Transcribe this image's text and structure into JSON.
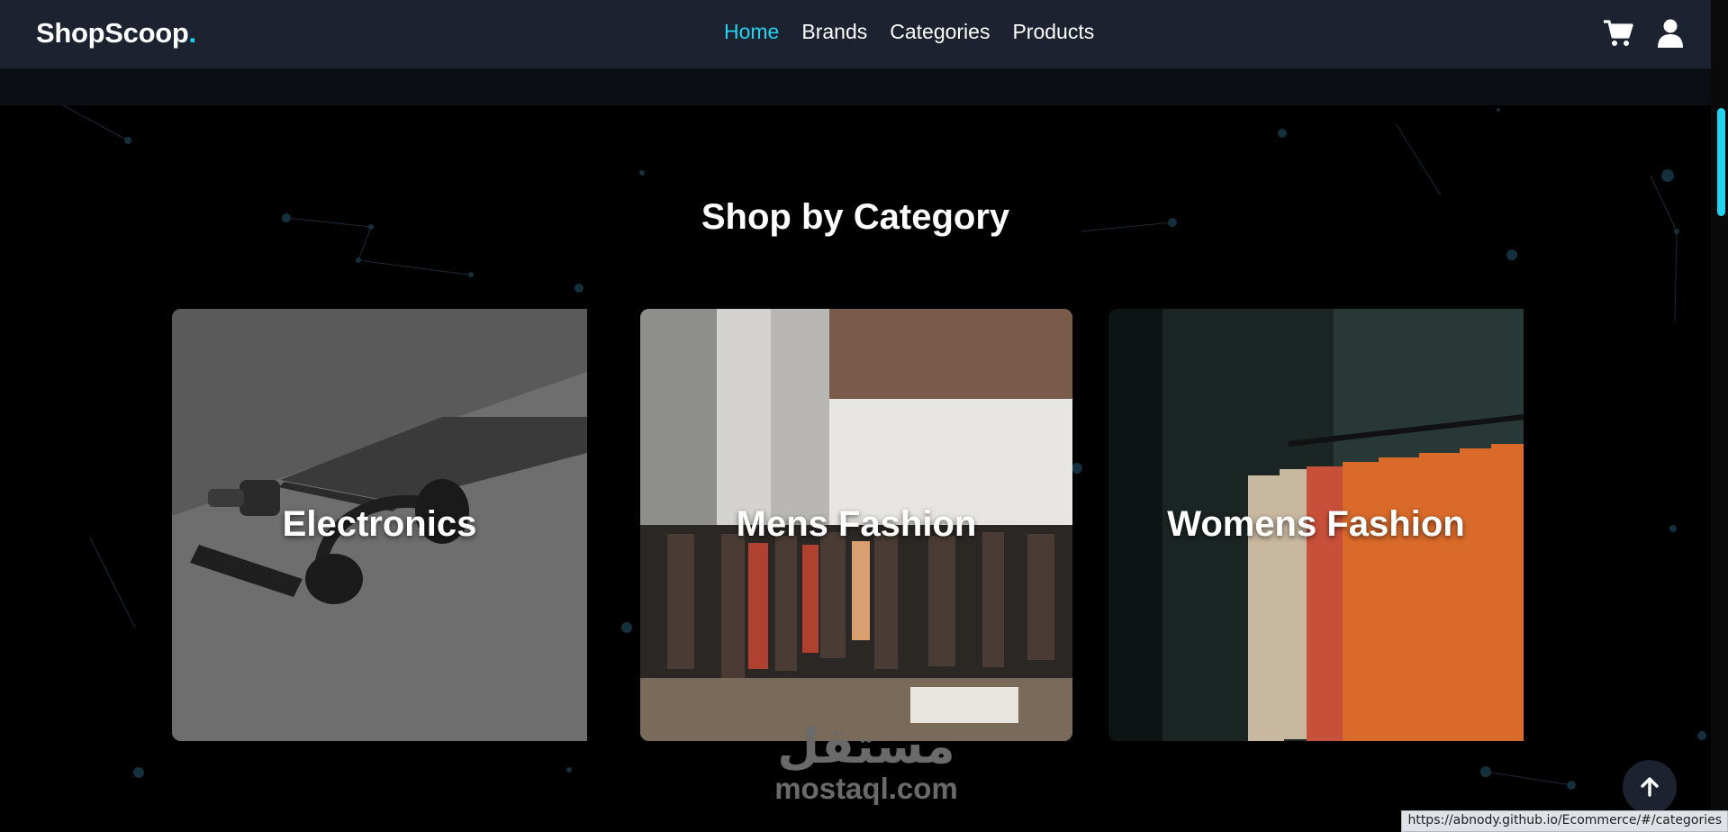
{
  "navbar": {
    "logo_text": "ShopScoop",
    "logo_dot": ".",
    "links": [
      {
        "label": "Home",
        "active": true
      },
      {
        "label": "Brands",
        "active": false
      },
      {
        "label": "Categories",
        "active": false
      },
      {
        "label": "Products",
        "active": false
      }
    ],
    "icons": [
      "cart-icon",
      "user-icon"
    ]
  },
  "section": {
    "title": "Shop by Category"
  },
  "categories": [
    {
      "label": "Electronics"
    },
    {
      "label": "Mens Fashion"
    },
    {
      "label": "Womens Fashion"
    }
  ],
  "watermark": {
    "arabic": "مستقل",
    "latin": "mostaql.com"
  },
  "status_bar": {
    "url": "https://abnody.github.io/Ecommerce/#/categories"
  },
  "colors": {
    "accent": "#22d3ee",
    "navbar": "#1c2230",
    "background": "#000000"
  }
}
